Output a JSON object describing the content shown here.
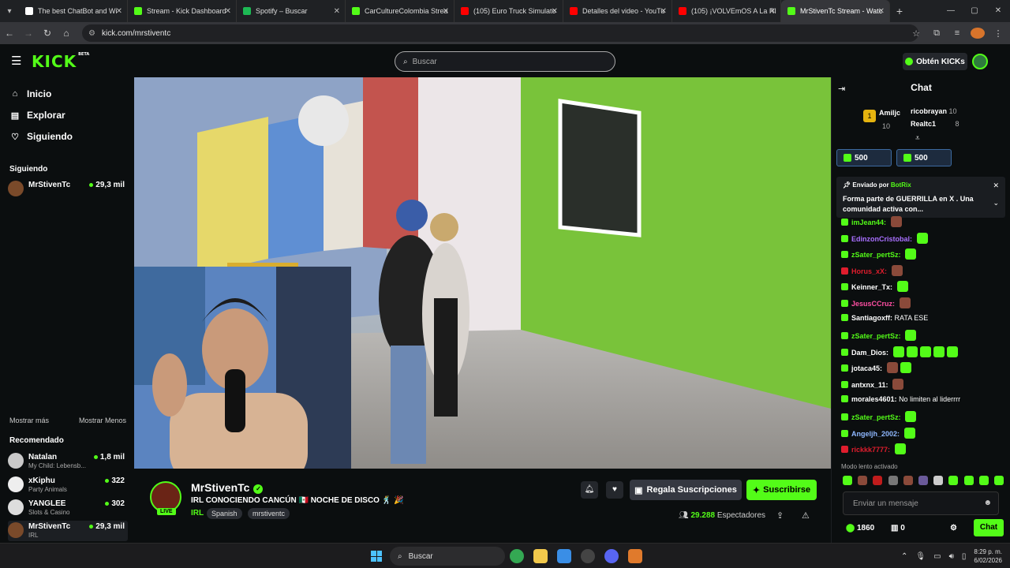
{
  "browser": {
    "tabs": [
      {
        "label": "The best ChatBot and Wi",
        "color": "#ffffff"
      },
      {
        "label": "Stream - Kick Dashboard",
        "color": "#53fc18"
      },
      {
        "label": "Spotify – Buscar",
        "color": "#1db954"
      },
      {
        "label": "CarCultureColombia Strea",
        "color": "#53fc18"
      },
      {
        "label": "(105) Euro Truck Simulato",
        "color": "#ff0000"
      },
      {
        "label": "Detalles del video - YouTu",
        "color": "#ff0000"
      },
      {
        "label": "(105) ¡VOLVEmOS A La RI",
        "color": "#ff0000"
      },
      {
        "label": "MrStivenTc Stream - Watc",
        "color": "#53fc18"
      }
    ],
    "url": "kick.com/mrstiventc"
  },
  "header": {
    "logo": "KICK",
    "logo_sup": "BETA",
    "search_placeholder": "Buscar",
    "get_kicks": "Obtén KICKs"
  },
  "sidebar": {
    "nav": [
      {
        "label": "Inicio",
        "icon": "home-icon"
      },
      {
        "label": "Explorar",
        "icon": "compass-icon"
      },
      {
        "label": "Siguiendo",
        "icon": "heart-icon"
      }
    ],
    "following_title": "Siguiendo",
    "following": [
      {
        "name": "MrStivenTc",
        "viewers": "29,3 mil"
      }
    ],
    "show_more": "Mostrar más",
    "show_less": "Mostrar Menos",
    "recommended_title": "Recomendado",
    "recommended": [
      {
        "name": "Natalan",
        "category": "My Child: Lebensb...",
        "viewers": "1,8 mil"
      },
      {
        "name": "xKiphu",
        "category": "Party Animals",
        "viewers": "322"
      },
      {
        "name": "YANGLEE",
        "category": "Slots & Casino",
        "viewers": "302"
      },
      {
        "name": "MrStivenTc",
        "category": "IRL",
        "viewers": "29,3 mil"
      }
    ]
  },
  "stream": {
    "streamer": "MrStivenTc",
    "live": "LIVE",
    "title": "IRL CONOCIENDO CANCÚN 🇲🇽 NOCHE DE DISCO 🕺 🎉",
    "category": "IRL",
    "tags": [
      "Spanish",
      "mrstiventc"
    ],
    "gift_label": "Regala Suscripciones",
    "subscribe_label": "Suscribirse",
    "viewer_count": "29.288",
    "viewer_label": "Espectadores"
  },
  "chat": {
    "title": "Chat",
    "leaderboard": [
      {
        "name": "Amiljc",
        "count": "10"
      },
      {
        "name": "ricobrayan",
        "count": "10"
      },
      {
        "name": "Realtc1",
        "count": "8"
      }
    ],
    "kick_pills": [
      "500",
      "500"
    ],
    "pinned_by_label": "Enviado por",
    "pinned_by": "BotRix",
    "pinned_text": "Forma parte de GUERRILLA  en X . Una comunidad activa con...",
    "messages": [
      {
        "user": "imJean44:",
        "text": "",
        "color": "#53fc18",
        "emotes": 1,
        "face": true
      },
      {
        "user": "EdinzonCristobal:",
        "text": "",
        "color": "#a970ff",
        "emotes": 1,
        "face": false
      },
      {
        "user": "zSater_pertSz:",
        "text": "",
        "color": "#53fc18",
        "emotes": 1,
        "face": false
      },
      {
        "user": "Horus_xX:",
        "text": "",
        "color": "#e01d2d",
        "emotes": 1,
        "face": true
      },
      {
        "user": "Keinner_Tx:",
        "text": "",
        "color": "#ffffff",
        "emotes": 1,
        "face": false
      },
      {
        "user": "JesusCCruz:",
        "text": "",
        "color": "#ff4fa3",
        "emotes": 1,
        "face": true
      },
      {
        "user": "Santiagoxff:",
        "text": "RATA ESE",
        "color": "#ffffff",
        "emotes": 0,
        "face": false
      },
      {
        "user": "zSater_pertSz:",
        "text": "",
        "color": "#53fc18",
        "emotes": 1,
        "face": false
      },
      {
        "user": "Dam_Dios:",
        "text": "",
        "color": "#ffffff",
        "emotes": 5,
        "face": false
      },
      {
        "user": "jotaca45:",
        "text": "",
        "color": "#ffffff",
        "emotes": 2,
        "face": true
      },
      {
        "user": "antxnx_11:",
        "text": "",
        "color": "#ffffff",
        "emotes": 1,
        "face": true
      },
      {
        "user": "morales4601:",
        "text": "No limiten al liderrrr",
        "color": "#ffffff",
        "emotes": 0,
        "face": false
      },
      {
        "user": "zSater_pertSz:",
        "text": "",
        "color": "#53fc18",
        "emotes": 1,
        "face": false
      },
      {
        "user": "Angelјh_2002:",
        "text": "",
        "color": "#8fb8ff",
        "emotes": 1,
        "face": false
      },
      {
        "user": "rickkk7777:",
        "text": "",
        "color": "#e01d2d",
        "emotes": 1,
        "face": false
      }
    ],
    "slow_mode": "Modo lento activado",
    "input_placeholder": "Enviar un mensaje",
    "kicks_balance": "1860",
    "other_balance": "0",
    "chat_button": "Chat"
  },
  "taskbar": {
    "search": "Buscar",
    "time": "8:29 p. m.",
    "date": "6/02/2026"
  }
}
